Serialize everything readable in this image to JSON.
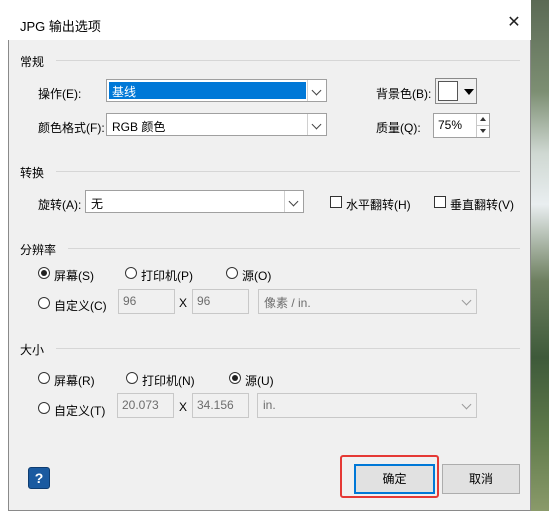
{
  "window": {
    "title": "JPG 输出选项",
    "close_label": "✕"
  },
  "general": {
    "heading": "常规",
    "operation_label": "操作(E):",
    "operation_value": "基线",
    "color_format_label": "颜色格式(F):",
    "color_format_value": "RGB 颜色",
    "background_label": "背景色(B):",
    "quality_label": "质量(Q):",
    "quality_value": "75%"
  },
  "transform": {
    "heading": "转换",
    "rotate_label": "旋转(A):",
    "rotate_value": "无",
    "flip_h_label": "水平翻转(H)",
    "flip_v_label": "垂直翻转(V)"
  },
  "resolution": {
    "heading": "分辨率",
    "screen_label": "屏幕(S)",
    "printer_label": "打印机(P)",
    "source_label": "源(O)",
    "custom_label": "自定义(C)",
    "x_value": "96",
    "y_value": "96",
    "x_sep": "X",
    "unit_value": "像素 / in.",
    "selected": "screen"
  },
  "size": {
    "heading": "大小",
    "screen_label": "屏幕(R)",
    "printer_label": "打印机(N)",
    "source_label": "源(U)",
    "custom_label": "自定义(T)",
    "w_value": "20.073",
    "h_value": "34.156",
    "x_sep": "X",
    "unit_value": "in.",
    "selected": "source"
  },
  "footer": {
    "help_label": "?",
    "ok_label": "确定",
    "cancel_label": "取消"
  },
  "colors": {
    "accent": "#0078d7",
    "highlight_box": "#e53935"
  }
}
